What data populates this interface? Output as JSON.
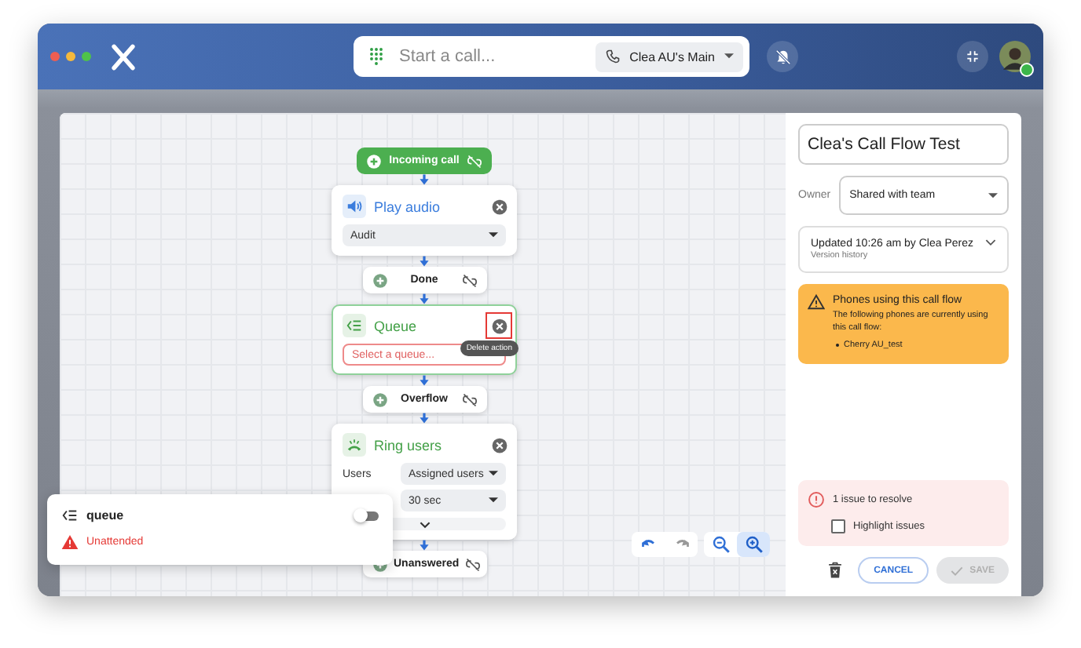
{
  "topbar": {
    "call_field": {
      "placeholder": "Start a call..."
    },
    "line_selector": "Clea AU's Main",
    "notifications_muted": true,
    "user_online": true
  },
  "flow": [
    {
      "kind": "start",
      "label": "Incoming call"
    },
    {
      "kind": "play_audio",
      "title": "Play audio",
      "color": "#3b7ddd",
      "selected": false,
      "close_highlighted": false,
      "fields": [
        {
          "value": "Audit",
          "error": false
        }
      ]
    },
    {
      "kind": "outcome",
      "label": "Done"
    },
    {
      "kind": "queue",
      "title": "Queue",
      "color": "#43a047",
      "selected": true,
      "close_highlighted": true,
      "tooltip": "Delete action",
      "fields": [
        {
          "placeholder": "Select a queue...",
          "error": true
        }
      ]
    },
    {
      "kind": "outcome",
      "label": "Overflow"
    },
    {
      "kind": "ring_users",
      "title": "Ring users",
      "color": "#43a047",
      "selected": false,
      "close_highlighted": false,
      "expandable": true,
      "fields": [
        {
          "label": "Users",
          "value": "Assigned users",
          "error": false
        },
        {
          "value": "30 sec",
          "error": false
        }
      ]
    },
    {
      "kind": "outcome",
      "label": "Unanswered"
    }
  ],
  "canvas_tools": [
    {
      "kind": "undo",
      "disabled": false,
      "selected": false
    },
    {
      "kind": "redo",
      "disabled": true,
      "selected": false
    },
    {
      "kind": "zoom_out",
      "disabled": false,
      "selected": false
    },
    {
      "kind": "zoom_in",
      "disabled": false,
      "selected": true
    }
  ],
  "overlay_card": {
    "title": "queue",
    "on": false,
    "status": "Unattended"
  },
  "panel": {
    "title": "Clea's Call Flow Test",
    "owner": {
      "label": "Owner",
      "value": "Shared with team"
    },
    "version": {
      "text": "Updated 10:26 am by Clea Perez",
      "link": "Version history"
    },
    "warning": {
      "title": "Phones using this call flow",
      "text": "The following phones are currently using this call flow:",
      "phones": [
        "Cherry AU_test"
      ]
    },
    "issues": {
      "text": "1 issue to resolve",
      "checkbox": {
        "label": "Highlight issues",
        "checked": false
      }
    },
    "actions": [
      {
        "kind": "delete",
        "disabled": false
      },
      {
        "kind": "cancel",
        "label": "CANCEL",
        "disabled": false
      },
      {
        "kind": "save",
        "label": "SAVE",
        "disabled": true
      }
    ]
  }
}
